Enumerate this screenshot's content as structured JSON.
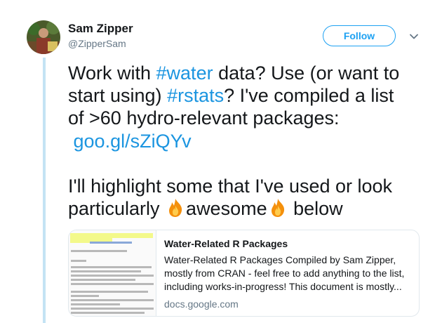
{
  "author": {
    "name": "Sam Zipper",
    "handle": "@ZipperSam"
  },
  "actions": {
    "follow_label": "Follow"
  },
  "tweet": {
    "line1": [
      "Work with ",
      "#water",
      " data? Use (or want to"
    ],
    "line2": [
      "start using) ",
      "#rstats",
      "? I've compiled a list"
    ],
    "line3": "of >60 hydro-relevant packages:",
    "link": "goo.gl/sZiQYv",
    "line5": " I'll highlight some that I've used or look",
    "line6": [
      "particularly ",
      "awesome",
      " below"
    ]
  },
  "card": {
    "title": "Water-Related R Packages",
    "description": "Water-Related R Packages Compiled by Sam Zipper, mostly from CRAN - feel free to add anything to the list, including works-in-progress! This document is mostly...",
    "domain": "docs.google.com"
  },
  "colors": {
    "link": "#1b95e0",
    "follow": "#1da1f2",
    "thread": "#c4e3f4"
  }
}
